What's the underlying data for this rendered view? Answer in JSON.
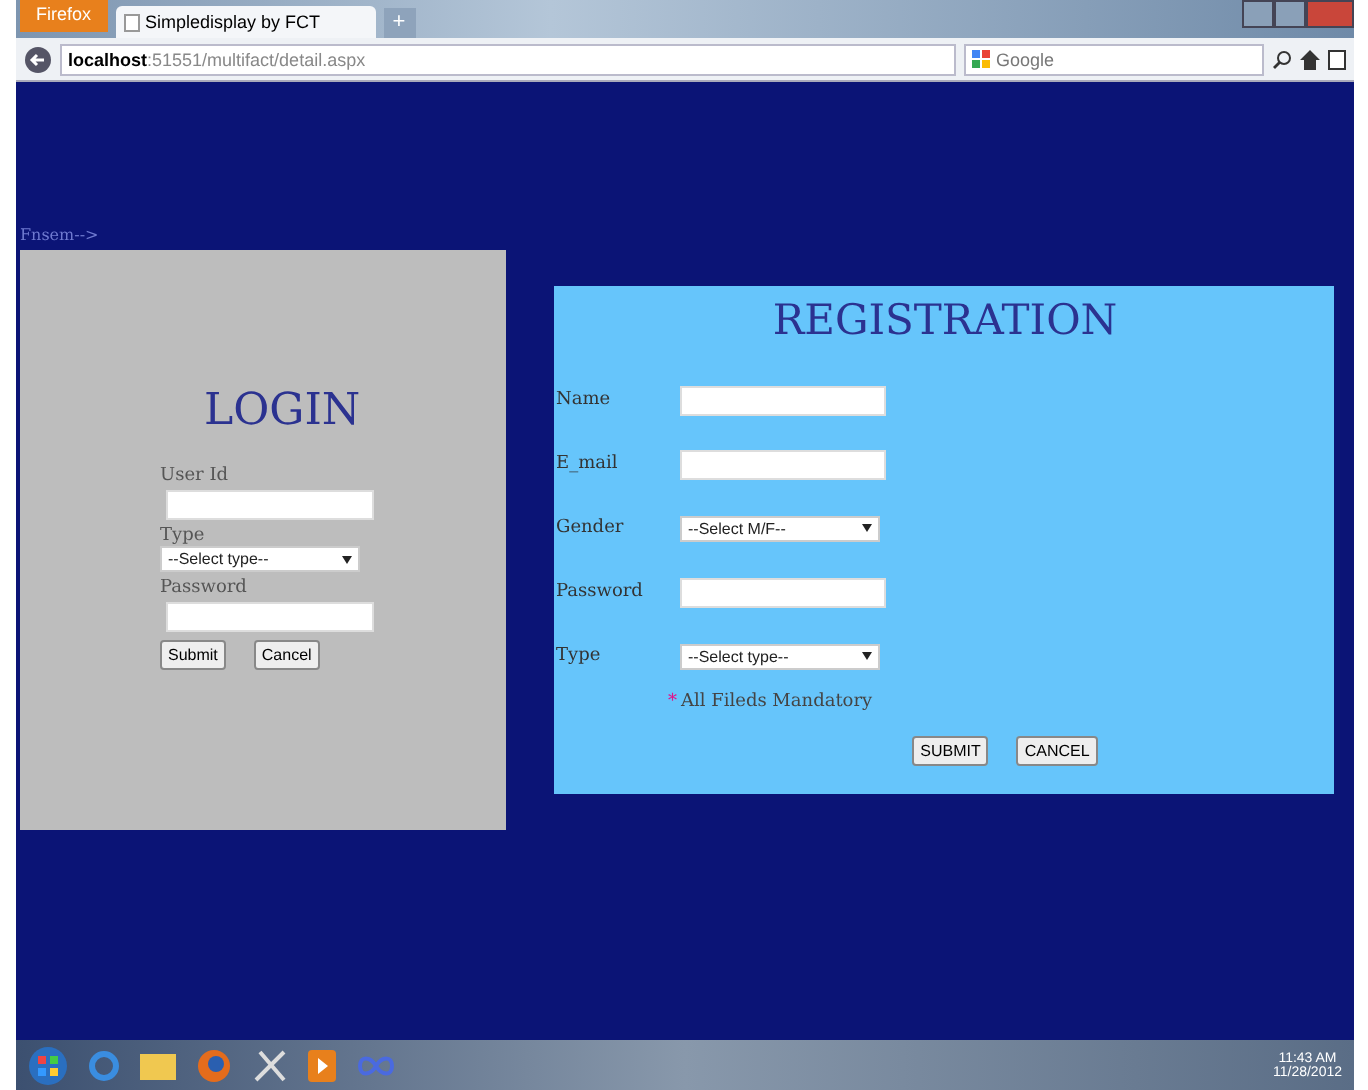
{
  "browser": {
    "menu_button": "Firefox",
    "tab": {
      "title": "Simpledisplay by FCT",
      "selected": true
    },
    "new_tab": "+",
    "url_host": "localhost",
    "url_path": ":51551/multifact/detail.aspx",
    "search_placeholder": "Google"
  },
  "page": {
    "breadcrumb": "Fnsem-->",
    "login": {
      "title": "LOGIN",
      "fields": [
        {
          "kind": "text",
          "label": "User Id"
        },
        {
          "kind": "select",
          "label": "Type",
          "value": "--Select type--"
        },
        {
          "kind": "text",
          "label": "Password"
        }
      ],
      "buttons": [
        "Submit",
        "Cancel"
      ]
    },
    "registration": {
      "title": "REGISTRATION",
      "fields": [
        {
          "kind": "text",
          "label": "Name"
        },
        {
          "kind": "text",
          "label": "E_mail"
        },
        {
          "kind": "select",
          "label": "Gender",
          "value": "--Select M/F--"
        },
        {
          "kind": "text",
          "label": "Password"
        },
        {
          "kind": "select",
          "label": "Type",
          "value": "--Select type--"
        }
      ],
      "note_mark": "*",
      "note": "All Fileds Mandatory",
      "buttons": [
        "SUBMIT",
        "CANCEL"
      ]
    }
  },
  "taskbar": {
    "time": "11:43 AM",
    "date": "11/28/2012"
  }
}
